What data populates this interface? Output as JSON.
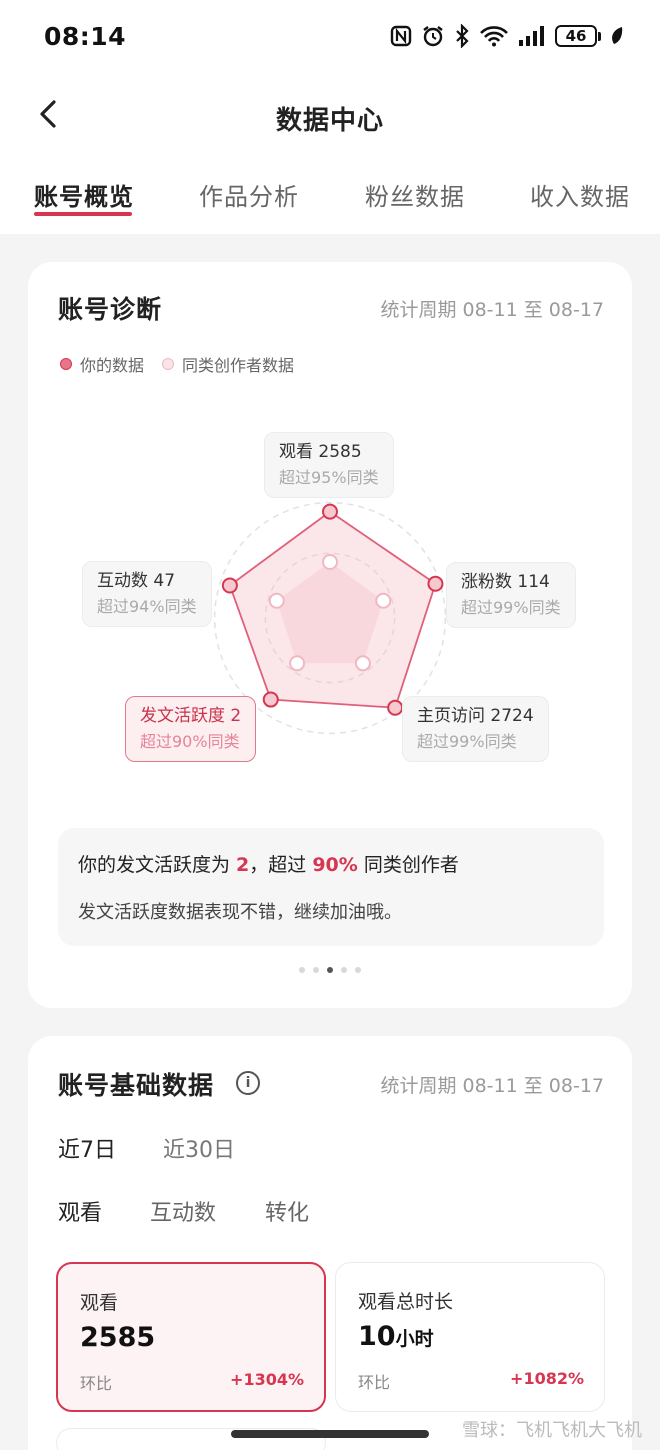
{
  "status_bar": {
    "time": "08:14",
    "battery": "46"
  },
  "nav": {
    "title": "数据中心"
  },
  "tabs": [
    {
      "label": "账号概览",
      "active": true
    },
    {
      "label": "作品分析",
      "active": false
    },
    {
      "label": "粉丝数据",
      "active": false
    },
    {
      "label": "收入数据",
      "active": false
    }
  ],
  "diagnosis": {
    "title": "账号诊断",
    "period": "统计周期 08-11 至 08-17",
    "legend": {
      "mine": "你的数据",
      "peers": "同类创作者数据"
    },
    "radar": [
      {
        "label": "观看 2585",
        "sub": "超过95%同类",
        "value": 0.95,
        "peer": 0.5
      },
      {
        "label": "涨粉数 114",
        "sub": "超过99%同类",
        "value": 0.99,
        "peer": 0.5
      },
      {
        "label": "主页访问 2724",
        "sub": "超过99%同类",
        "value": 0.99,
        "peer": 0.5
      },
      {
        "label": "发文活跃度 2",
        "sub": "超过90%同类",
        "value": 0.9,
        "peer": 0.5
      },
      {
        "label": "互动数 47",
        "sub": "超过94%同类",
        "value": 0.94,
        "peer": 0.5
      }
    ],
    "summary": {
      "prefix": "你的发文活跃度为 ",
      "value": "2",
      "middle": "，超过 ",
      "percent": "90%",
      "suffix": " 同类创作者",
      "detail": "发文活跃度数据表现不错，继续加油哦。"
    }
  },
  "basic": {
    "title": "账号基础数据",
    "info_icon": "i",
    "period": "统计周期 08-11 至 08-17",
    "ranges": [
      "近7日",
      "近30日"
    ],
    "metric_tabs": [
      "观看",
      "互动数",
      "转化"
    ],
    "stats": [
      {
        "label": "观看",
        "value": "2585",
        "unit": "",
        "hb": "环比",
        "change": "+1304%"
      },
      {
        "label": "观看总时长",
        "value": "10",
        "unit": "小时",
        "hb": "环比",
        "change": "+1082%"
      }
    ]
  },
  "watermark": "雪球：飞机飞机大飞机",
  "colors": {
    "accent": "#d6364f",
    "peer_fill": "#f8d9de"
  }
}
